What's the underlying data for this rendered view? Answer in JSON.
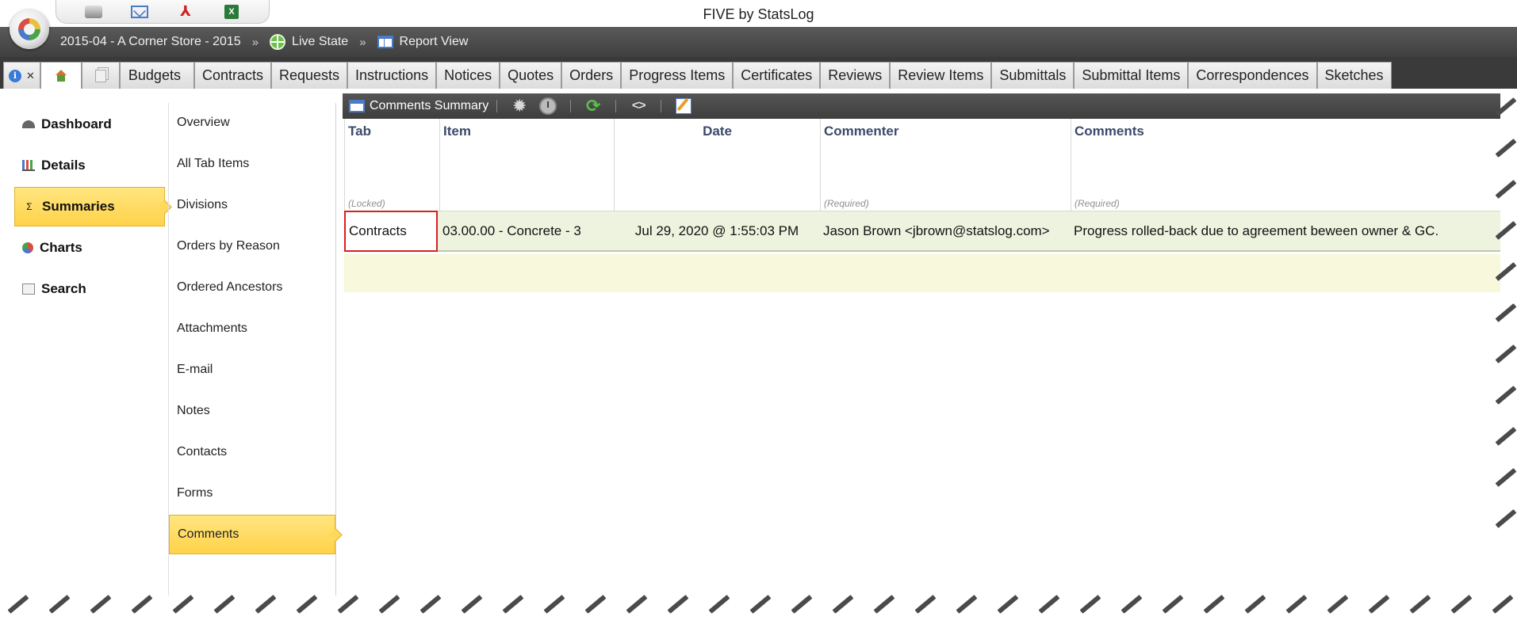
{
  "window": {
    "title": "FIVE by StatsLog"
  },
  "quick_bar": {
    "icons": [
      "print-icon",
      "email-icon",
      "pdf-icon",
      "excel-icon"
    ]
  },
  "breadcrumb": {
    "project": "2015-04 - A Corner Store - 2015",
    "separator": "»",
    "state": "Live State",
    "view": "Report View"
  },
  "tabs": {
    "items": [
      "Budgets",
      "Contracts",
      "Requests",
      "Instructions",
      "Notices",
      "Quotes",
      "Orders",
      "Progress Items",
      "Certificates",
      "Reviews",
      "Review Items",
      "Submittals",
      "Submittal Items",
      "Correspondences",
      "Sketches"
    ],
    "close_glyph": "✕",
    "info_glyph": "i"
  },
  "left_nav": {
    "items": [
      "Dashboard",
      "Details",
      "Summaries",
      "Charts",
      "Search"
    ],
    "active": "Summaries",
    "summaries_glyph": "Σ"
  },
  "sub_nav": {
    "items": [
      "Overview",
      "All Tab Items",
      "Divisions",
      "Orders by Reason",
      "Ordered Ancestors",
      "Attachments",
      "E-mail",
      "Notes",
      "Contacts",
      "Forms",
      "Comments"
    ],
    "active": "Comments"
  },
  "report_toolbar": {
    "title": "Comments Summary",
    "gear_glyph": "✹",
    "refresh_glyph": "⟳",
    "code_glyph": "<>"
  },
  "grid": {
    "columns": [
      {
        "label": "Tab",
        "hint": "(Locked)"
      },
      {
        "label": "Item",
        "hint": ""
      },
      {
        "label": "Date",
        "hint": ""
      },
      {
        "label": "Commenter",
        "hint": "(Required)"
      },
      {
        "label": "Comments",
        "hint": "(Required)"
      }
    ],
    "rows": [
      {
        "tab": "Contracts",
        "item": "03.00.00 - Concrete - 3",
        "date": "Jul 29, 2020 @ 1:55:03 PM",
        "commenter": "Jason Brown <jbrown@statslog.com>",
        "comments": "Progress rolled-back due to agreement beween owner & GC."
      }
    ]
  },
  "colors": {
    "toolbar_dark": "#3a3a3a",
    "active_yellow": "#ffd24a",
    "row_green": "#eef3df",
    "row_empty": "#f8f8dc",
    "selection_red": "#d82020",
    "header_text": "#3a4a6a"
  }
}
